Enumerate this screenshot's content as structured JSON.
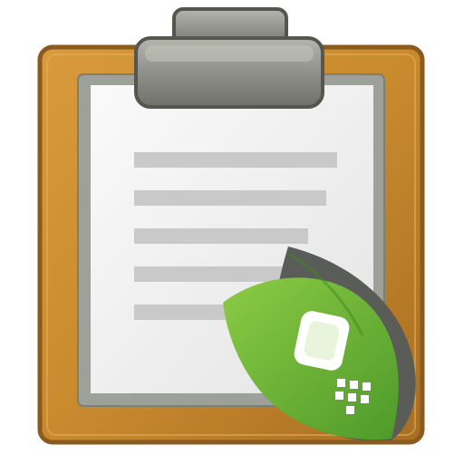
{
  "icon": {
    "name": "clipboard-with-phone-leaf",
    "depicts": [
      "clipboard-icon",
      "document-lines-icon",
      "leaf-icon",
      "phone-icon"
    ],
    "colors": {
      "board": "#C98A2E",
      "board_edge": "#8A5A1E",
      "clip": "#8F918A",
      "clip_edge": "#55574F",
      "paper": "#F3F3F3",
      "paper_frame": "#9EA09A",
      "text_lines": "#C9C9C9",
      "leaf_light": "#7FC23E",
      "leaf_dark": "#3E8A22",
      "leaf_shadow": "#5A5C58",
      "phone": "#FFFFFF"
    }
  }
}
